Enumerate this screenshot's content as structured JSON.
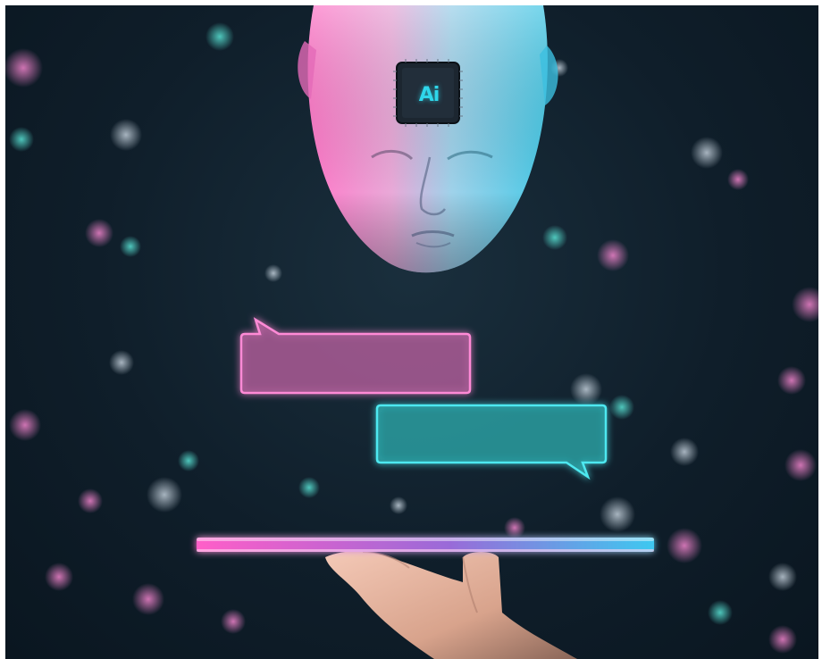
{
  "scene": {
    "chip_label": "Ai",
    "colors": {
      "background": "#0f1e2a",
      "pink_glow": "#ff7ad9",
      "cyan_glow": "#3ee0f0",
      "chip_text": "#2fd6ea"
    },
    "icons": [
      "robot-head",
      "ai-chip",
      "chat-bubble-left",
      "chat-bubble-right",
      "tablet",
      "hand"
    ]
  }
}
